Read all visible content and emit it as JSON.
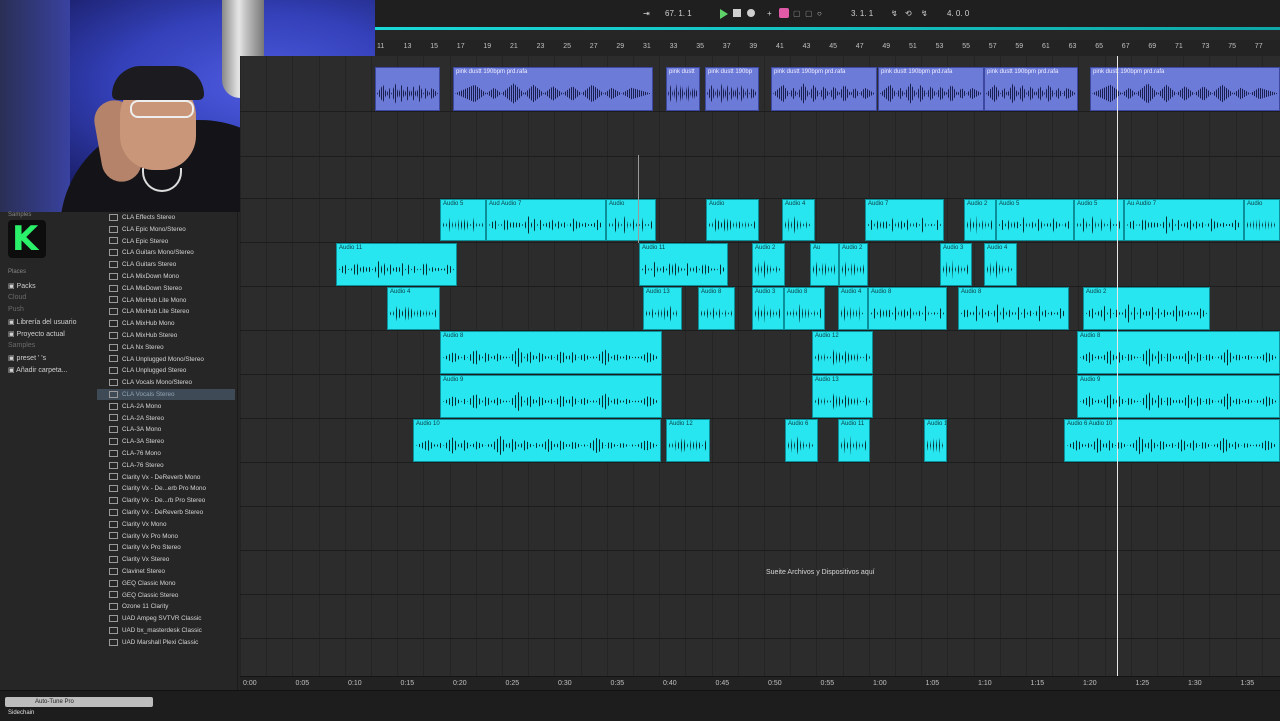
{
  "transport": {
    "position": "67. 1. 1",
    "loop_start": "3. 1. 1",
    "loop_length": "4. 0. 0"
  },
  "ruler": {
    "bars": [
      "11",
      "13",
      "15",
      "17",
      "19",
      "21",
      "23",
      "25",
      "27",
      "29",
      "31",
      "33",
      "35",
      "37",
      "39",
      "41",
      "43",
      "45",
      "47",
      "49",
      "51",
      "53",
      "55",
      "57",
      "59",
      "61",
      "63",
      "65",
      "67",
      "69",
      "71",
      "73",
      "75",
      "77"
    ]
  },
  "time_ruler": {
    "labels": [
      "0:00",
      "0:05",
      "0:10",
      "0:15",
      "0:20",
      "0:25",
      "0:30",
      "0:35",
      "0:40",
      "0:45",
      "0:50",
      "0:55",
      "1:00",
      "1:05",
      "1:10",
      "1:15",
      "1:20",
      "1:25",
      "1:30",
      "1:35"
    ]
  },
  "places": {
    "header_samples": "Samples",
    "places_label": "Places",
    "items": [
      "Packs",
      "Cloud",
      "Push",
      "Librería del usuario",
      "Proyecto actual",
      "Samples",
      "preset ' 's",
      "Añadir carpeta..."
    ]
  },
  "plugins": [
    "CLA Effects Stereo",
    "CLA Epic Mono/Stereo",
    "CLA Epic Stereo",
    "CLA Guitars Mono/Stereo",
    "CLA Guitars Stereo",
    "CLA MixDown Mono",
    "CLA MixDown Stereo",
    "CLA MixHub Lite Mono",
    "CLA MixHub Lite Stereo",
    "CLA MixHub Mono",
    "CLA MixHub Stereo",
    "CLA Nx Stereo",
    "CLA Unplugged Mono/Stereo",
    "CLA Unplugged Stereo",
    "CLA Vocals Mono/Stereo",
    "CLA Vocals Stereo",
    "CLA-2A Mono",
    "CLA-2A Stereo",
    "CLA-3A Mono",
    "CLA-3A Stereo",
    "CLA-76 Mono",
    "CLA-76 Stereo",
    "Clarity Vx - DeReverb Mono",
    "Clarity Vx - De...erb Pro Mono",
    "Clarity Vx - De...rb Pro Stereo",
    "Clarity Vx - DeReverb Stereo",
    "Clarity Vx Mono",
    "Clarity Vx Pro Mono",
    "Clarity Vx Pro Stereo",
    "Clarity Vx Stereo",
    "Clavinet Stereo",
    "GEQ Classic Mono",
    "GEQ Classic Stereo",
    "Ozone 11 Clarity",
    "UAD Ampeg SVTVR Classic",
    "UAD bx_masterdesk Classic",
    "UAD Marshall Plexi Classic"
  ],
  "selected_plugin": "CLA Vocals Stereo",
  "arrangement": {
    "drop_message": "Sueite Archivos y Dispositivos aquí",
    "purple_clips": [
      {
        "name": ""
      },
      {
        "name": "pink dustt 190bpm prd.rafa"
      },
      {
        "name": "pink dustt"
      },
      {
        "name": "pink dustt 190bp"
      },
      {
        "name": "pink dustt 190bpm prd.rafa"
      },
      {
        "name": "pink dustt 190bpm prd.rafa"
      },
      {
        "name": "pink dustt 190bpm prd.rafa"
      },
      {
        "name": "pink dustt 190bpm prd.rafa"
      }
    ],
    "clips": [
      {
        "name": "Audio 5"
      },
      {
        "name": "Aud Audio 7"
      },
      {
        "name": "Audio"
      },
      {
        "name": "Audio"
      },
      {
        "name": "Audio 4"
      },
      {
        "name": "Audio 7"
      },
      {
        "name": "Audio 2"
      },
      {
        "name": "Audio 5"
      },
      {
        "name": "Audio 5"
      },
      {
        "name": "Au Audio 7"
      },
      {
        "name": "Audio"
      },
      {
        "name": "Audio 11"
      },
      {
        "name": "Audio 11"
      },
      {
        "name": "Audio 2"
      },
      {
        "name": "Au"
      },
      {
        "name": "Audio 2"
      },
      {
        "name": "Audio 3"
      },
      {
        "name": "Audio 4"
      },
      {
        "name": "Audio 4"
      },
      {
        "name": "Audio 13"
      },
      {
        "name": "Audio 8"
      },
      {
        "name": "Audio 3"
      },
      {
        "name": "Audio 8"
      },
      {
        "name": "Audio 4"
      },
      {
        "name": "Audio 8"
      },
      {
        "name": "Audio 8"
      },
      {
        "name": "Audio 2"
      },
      {
        "name": "Audio 8"
      },
      {
        "name": "Audio 12"
      },
      {
        "name": "Audio 8"
      },
      {
        "name": "Audio 9"
      },
      {
        "name": "Audio 13"
      },
      {
        "name": "Audio 9"
      },
      {
        "name": "Audio 10"
      },
      {
        "name": "Audio 12"
      },
      {
        "name": "Audio 6"
      },
      {
        "name": "Audio 11"
      },
      {
        "name": "Audio 1"
      },
      {
        "name": "Audio 6 Audio 10"
      }
    ]
  },
  "bottom": {
    "device_name": "Auto-Tune Pro",
    "sidechain": "Sidechain"
  }
}
